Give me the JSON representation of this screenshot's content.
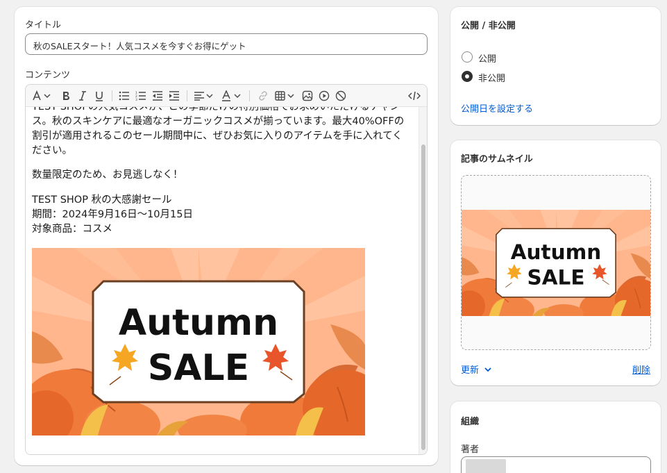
{
  "main": {
    "title_label": "タイトル",
    "title_value": "秋のSALEスタート！人気コスメを今すぐお得にゲット",
    "content_label": "コンテンツ",
    "toolbar_icons": [
      "font-icon",
      "bold-icon",
      "italic-icon",
      "underline-icon",
      "bullet-list-icon",
      "numbered-list-icon",
      "outdent-icon",
      "indent-icon",
      "align-left-icon",
      "text-color-icon",
      "link-icon",
      "table-icon",
      "image-icon",
      "video-icon",
      "clear-formatting-icon",
      "code-view-icon"
    ],
    "paragraphs": [
      "TEST SHOPの人気コスメが、この季節だけの特別価格でお求めいただけるチャンス。秋のスキンケアに最適なオーガニックコスメが揃っています。最大40%OFFの割引が適用されるこのセール期間中に、ぜひお気に入りのアイテムを手に入れてください。",
      "数量限定のため、お見逃しなく！",
      "TEST SHOP 秋の大感謝セール",
      "期間：2024年9月16日〜10月15日",
      "対象商品：コスメ"
    ],
    "image_text_line1": "Autumn",
    "image_text_line2": "SALE"
  },
  "visibility": {
    "heading": "公開 / 非公開",
    "option_public": "公開",
    "option_private": "非公開",
    "selected": "非公開",
    "set_date_link": "公開日を設定する"
  },
  "thumbnail": {
    "heading": "記事のサムネイル",
    "image_text_line1": "Autumn",
    "image_text_line2": "SALE",
    "update_label": "更新",
    "delete_label": "削除"
  },
  "organization": {
    "heading": "組織",
    "author_label": "著者"
  },
  "colors": {
    "link": "#005bd3",
    "banner_bg": "#ffb487",
    "pumpkin": "#f07a3a",
    "frame": "#6b3f22"
  }
}
